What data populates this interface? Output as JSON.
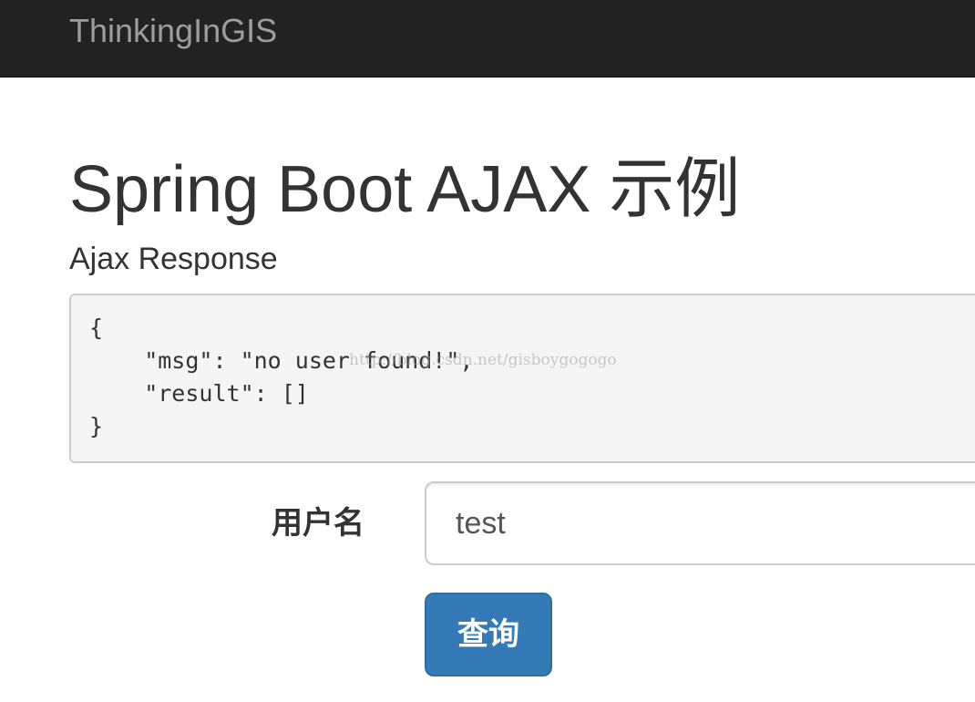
{
  "navbar": {
    "brand": "ThinkingInGIS"
  },
  "main": {
    "title": "Spring Boot AJAX 示例",
    "response_heading": "Ajax Response",
    "response_body": "{\n    \"msg\": \"no user found!\",\n    \"result\": []\n}",
    "watermark": "http://blog.csdn.net/gisboygogogo"
  },
  "form": {
    "username_label": "用户名",
    "username_value": "test",
    "search_label": "查询"
  },
  "colors": {
    "navbar_bg": "#222222",
    "brand_text": "#9d9d9d",
    "primary_button": "#337ab7",
    "response_bg": "#f5f5f5"
  }
}
